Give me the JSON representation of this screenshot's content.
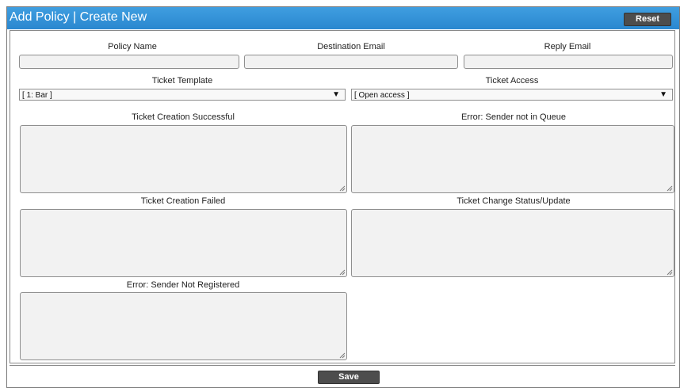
{
  "header": {
    "title": "Add Policy | Create New",
    "reset_label": "Reset"
  },
  "form": {
    "policy_name": {
      "label": "Policy Name",
      "value": ""
    },
    "destination_email": {
      "label": "Destination Email",
      "value": ""
    },
    "reply_email": {
      "label": "Reply Email",
      "value": ""
    },
    "ticket_template": {
      "label": "Ticket Template",
      "value": "[ 1: Bar ]"
    },
    "ticket_access": {
      "label": "Ticket Access",
      "value": "[ Open access ]"
    },
    "ticket_creation_successful": {
      "label": "Ticket Creation Successful",
      "value": ""
    },
    "error_sender_not_in_queue": {
      "label": "Error: Sender not in Queue",
      "value": ""
    },
    "ticket_creation_failed": {
      "label": "Ticket Creation Failed",
      "value": ""
    },
    "ticket_change_status_update": {
      "label": "Ticket Change Status/Update",
      "value": ""
    },
    "error_sender_not_registered": {
      "label": "Error: Sender Not Registered",
      "value": ""
    }
  },
  "footer": {
    "save_label": "Save"
  },
  "colors": {
    "title_bar": "#2a87cf",
    "button": "#4d4d4d",
    "field_bg": "#f2f2f2"
  },
  "icons": {
    "dropdown": "dropdown-arrow-icon",
    "resize": "resize-grip-icon"
  }
}
